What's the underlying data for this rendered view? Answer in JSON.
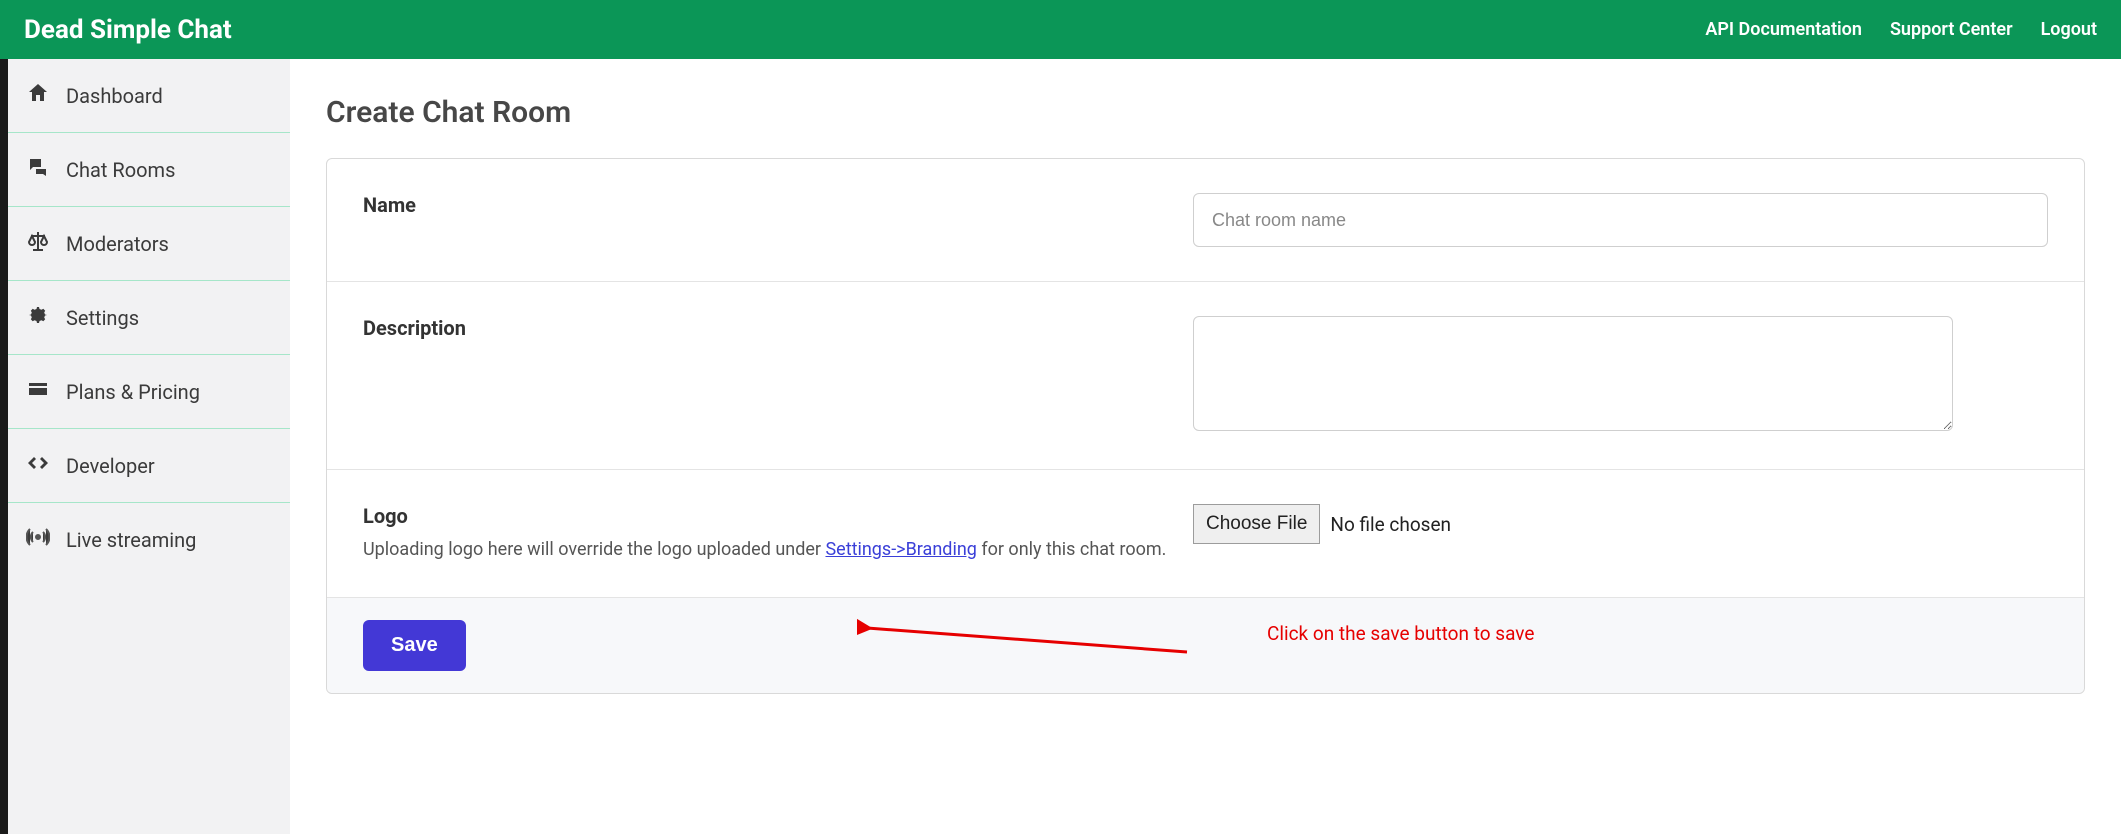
{
  "header": {
    "brand": "Dead Simple Chat",
    "nav": {
      "api_docs": "API Documentation",
      "support": "Support Center",
      "logout": "Logout"
    }
  },
  "sidebar": {
    "items": [
      {
        "label": "Dashboard",
        "icon": "home-icon"
      },
      {
        "label": "Chat Rooms",
        "icon": "chat-icon"
      },
      {
        "label": "Moderators",
        "icon": "scale-icon"
      },
      {
        "label": "Settings",
        "icon": "gear-icon"
      },
      {
        "label": "Plans & Pricing",
        "icon": "card-icon"
      },
      {
        "label": "Developer",
        "icon": "code-icon"
      },
      {
        "label": "Live streaming",
        "icon": "broadcast-icon"
      }
    ]
  },
  "main": {
    "title": "Create Chat Room",
    "form": {
      "name": {
        "label": "Name",
        "placeholder": "Chat room name",
        "value": ""
      },
      "description": {
        "label": "Description",
        "value": ""
      },
      "logo": {
        "label": "Logo",
        "help_pre": "Uploading logo here will override the logo uploaded under ",
        "help_link": "Settings->Branding",
        "help_post": " for only this chat room.",
        "choose_label": "Choose File",
        "file_status": "No file chosen"
      },
      "save_label": "Save"
    },
    "annotation": {
      "text": "Click on the save button to save"
    }
  }
}
